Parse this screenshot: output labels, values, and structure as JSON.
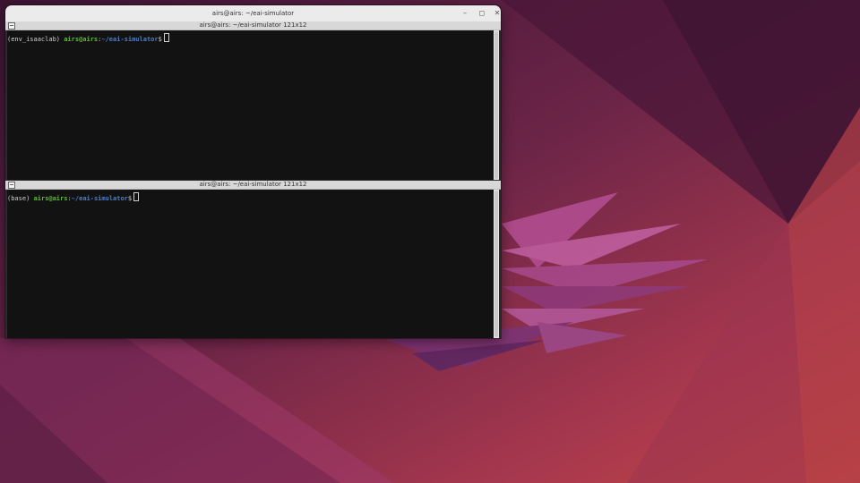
{
  "window": {
    "title": "airs@airs: ~/eai-simulator",
    "controls": {
      "minimize_icon": "–",
      "maximize_icon": "◻",
      "close_icon": "✕"
    }
  },
  "panes": [
    {
      "header": "airs@airs: ~/eai-simulator 121x12",
      "prompt": {
        "env": "(env_isaaclab) ",
        "user_host": "airs@airs",
        "colon": ":",
        "path": "~/eai-simulator",
        "symbol": "$"
      }
    },
    {
      "header": "airs@airs: ~/eai-simulator 121x12",
      "prompt": {
        "env": "(base) ",
        "user_host": "airs@airs",
        "colon": ":",
        "path": "~/eai-simulator",
        "symbol": "$"
      }
    }
  ],
  "colors": {
    "terminal_bg": "#121212",
    "prompt_user": "#5fb93a",
    "prompt_path": "#4a7fc8"
  }
}
